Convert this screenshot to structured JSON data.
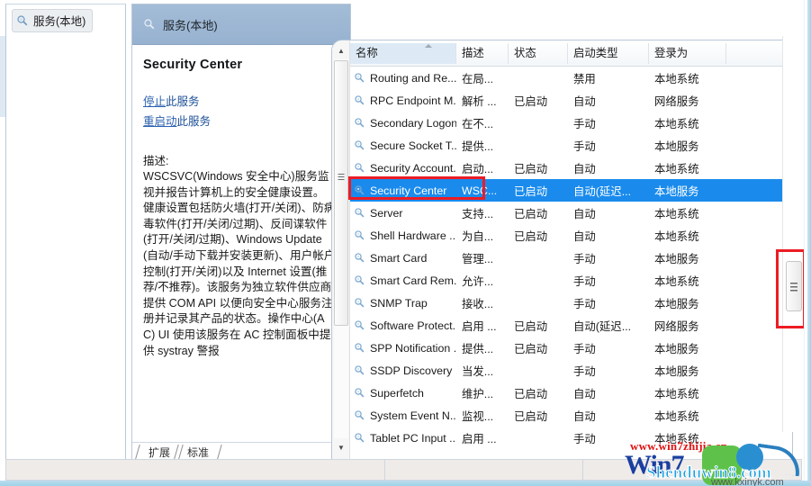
{
  "tree": {
    "node_label": "服务(本地)",
    "node_icon": "service-gear-icon"
  },
  "details": {
    "header_label": "服务(本地)",
    "header_icon": "service-gear-icon",
    "service_title": "Security Center",
    "links": [
      {
        "underlined": "停止",
        "rest": "此服务"
      },
      {
        "underlined": "重启动",
        "rest": "此服务"
      }
    ],
    "description_label": "描述:",
    "description_text": "WSCSVC(Windows 安全中心)服务监视并报告计算机上的安全健康设置。健康设置包括防火墙(打开/关闭)、防病毒软件(打开/关闭/过期)、反间谍软件(打开/关闭/过期)、Windows Update(自动/手动下载并安装更新)、用户帐户控制(打开/关闭)以及 Internet 设置(推荐/不推荐)。该服务为独立软件供应商提供 COM API 以便向安全中心服务注册并记录其产品的状态。操作中心(AC) UI 使用该服务在 AC 控制面板中提供 systray 警报",
    "tabs": [
      {
        "label": "扩展"
      },
      {
        "label": "标准"
      }
    ],
    "scroll_up_icon": "scroll-up-arrow-icon",
    "scroll_down_icon": "scroll-down-arrow-icon"
  },
  "list": {
    "columns": [
      {
        "key": "name",
        "label": "名称",
        "sorted": true
      },
      {
        "key": "desc",
        "label": "描述",
        "sorted": false
      },
      {
        "key": "stat",
        "label": "状态",
        "sorted": false
      },
      {
        "key": "start",
        "label": "启动类型",
        "sorted": false
      },
      {
        "key": "logon",
        "label": "登录为",
        "sorted": false
      }
    ],
    "sort_indicator_icon": "sort-ascending-icon",
    "row_icon": "service-gear-icon",
    "scroll_up_icon": "scroll-up-arrow-icon",
    "scroll_down_icon": "scroll-down-arrow-icon",
    "rows": [
      {
        "name": "Routing and Re...",
        "desc": "在局...",
        "stat": "",
        "start": "禁用",
        "logon": "本地系统",
        "selected": false
      },
      {
        "name": "RPC Endpoint M...",
        "desc": "解析 ...",
        "stat": "已启动",
        "start": "自动",
        "logon": "网络服务",
        "selected": false
      },
      {
        "name": "Secondary Logon",
        "desc": "在不...",
        "stat": "",
        "start": "手动",
        "logon": "本地系统",
        "selected": false
      },
      {
        "name": "Secure Socket T...",
        "desc": "提供...",
        "stat": "",
        "start": "手动",
        "logon": "本地服务",
        "selected": false
      },
      {
        "name": "Security Account...",
        "desc": "启动...",
        "stat": "已启动",
        "start": "自动",
        "logon": "本地系统",
        "selected": false
      },
      {
        "name": "Security Center",
        "desc": "WSC...",
        "stat": "已启动",
        "start": "自动(延迟...",
        "logon": "本地服务",
        "selected": true
      },
      {
        "name": "Server",
        "desc": "支持...",
        "stat": "已启动",
        "start": "自动",
        "logon": "本地系统",
        "selected": false
      },
      {
        "name": "Shell Hardware ...",
        "desc": "为自...",
        "stat": "已启动",
        "start": "自动",
        "logon": "本地系统",
        "selected": false
      },
      {
        "name": "Smart Card",
        "desc": "管理...",
        "stat": "",
        "start": "手动",
        "logon": "本地服务",
        "selected": false
      },
      {
        "name": "Smart Card Rem...",
        "desc": "允许...",
        "stat": "",
        "start": "手动",
        "logon": "本地系统",
        "selected": false
      },
      {
        "name": "SNMP Trap",
        "desc": "接收...",
        "stat": "",
        "start": "手动",
        "logon": "本地服务",
        "selected": false
      },
      {
        "name": "Software Protect...",
        "desc": "启用 ...",
        "stat": "已启动",
        "start": "自动(延迟...",
        "logon": "网络服务",
        "selected": false
      },
      {
        "name": "SPP Notification ...",
        "desc": "提供...",
        "stat": "已启动",
        "start": "手动",
        "logon": "本地服务",
        "selected": false
      },
      {
        "name": "SSDP Discovery",
        "desc": "当发...",
        "stat": "",
        "start": "手动",
        "logon": "本地服务",
        "selected": false
      },
      {
        "name": "Superfetch",
        "desc": "维护...",
        "stat": "已启动",
        "start": "自动",
        "logon": "本地系统",
        "selected": false
      },
      {
        "name": "System Event N...",
        "desc": "监视...",
        "stat": "已启动",
        "start": "自动",
        "logon": "本地系统",
        "selected": false
      },
      {
        "name": "Tablet PC Input ...",
        "desc": "启用 ...",
        "stat": "",
        "start": "手动",
        "logon": "本地系统",
        "selected": false
      }
    ]
  },
  "outer_scroll": {
    "thumb_label": "",
    "highlight_color": "#ec1c24"
  },
  "watermarks": {
    "url_top": "www.win7zhijia.cn",
    "logo_main": "Win7",
    "logo_sub": "Shenduwin8.com",
    "url_bottom": "www.kxinyk.com"
  },
  "colors": {
    "selection": "#1a8bec",
    "annotation": "#ec1c24",
    "header_band": "#9cb6d4",
    "link": "#1b4f96"
  }
}
